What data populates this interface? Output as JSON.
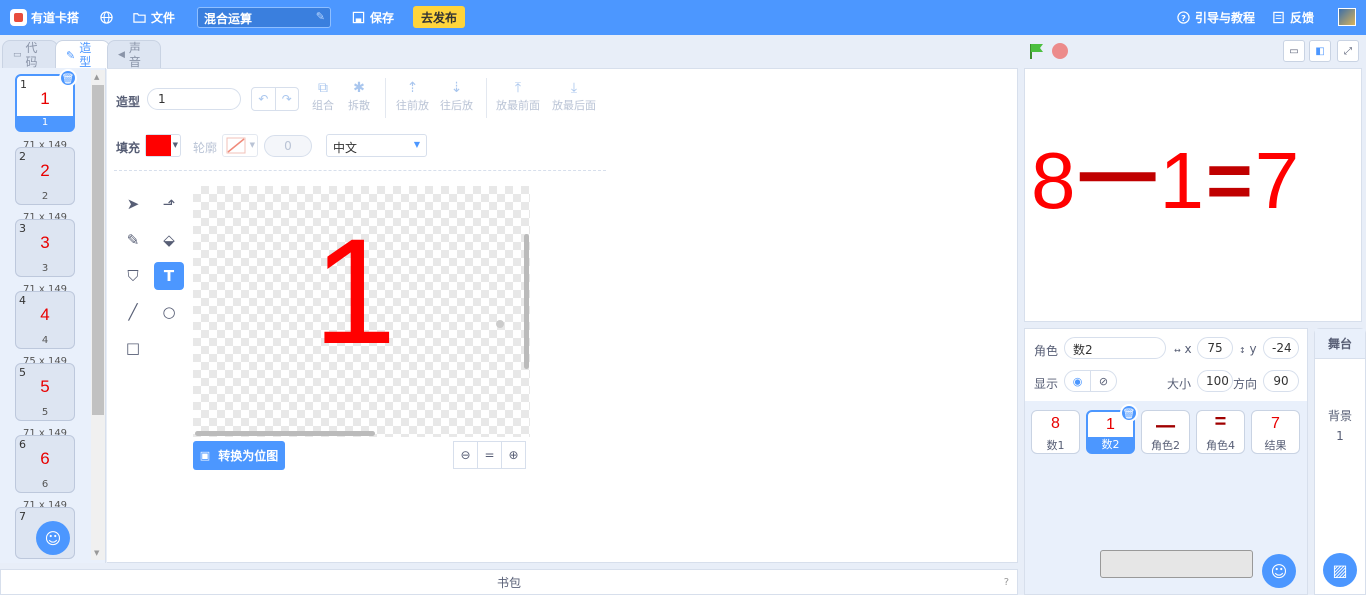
{
  "header": {
    "brand": "有道卡搭",
    "file_menu": "文件",
    "project_title": "混合运算",
    "save_label": "保存",
    "publish_label": "去发布",
    "guide_label": "引导与教程",
    "feedback_label": "反馈"
  },
  "tabs": {
    "code": [
      "代",
      "码"
    ],
    "costume": [
      "造",
      "型"
    ],
    "sound": [
      "声",
      "音"
    ]
  },
  "costumes": [
    {
      "num": "1",
      "glyph": "1",
      "name": "1",
      "size": "71 x 149"
    },
    {
      "num": "2",
      "glyph": "2",
      "name": "2",
      "size": "71 x 149"
    },
    {
      "num": "3",
      "glyph": "3",
      "name": "3",
      "size": "71 x 149"
    },
    {
      "num": "4",
      "glyph": "4",
      "name": "4",
      "size": "75 x 149"
    },
    {
      "num": "5",
      "glyph": "5",
      "name": "5",
      "size": "71 x 149"
    },
    {
      "num": "6",
      "glyph": "6",
      "name": "6",
      "size": "71 x 149"
    },
    {
      "num": "7"
    }
  ],
  "editor": {
    "costume_label": "造型",
    "costume_name": "1",
    "group": "组合",
    "ungroup": "拆散",
    "forward": "往前放",
    "backward": "往后放",
    "front": "放最前面",
    "back": "放最后面",
    "fill_label": "填充",
    "fill_color": "#ff0000",
    "outline_label": "轮廓",
    "outline_width": "0",
    "font": "中文",
    "canvas_glyph": "1",
    "convert_label": "转换为位图",
    "zoom_reset": "="
  },
  "backpack": "书包",
  "stage": {
    "parts": [
      "8",
      "一",
      "1",
      "=",
      "7"
    ]
  },
  "sprite_info": {
    "sprite_label": "角色",
    "sprite_name": "数2",
    "x_label": "x",
    "x": "75",
    "y_label": "y",
    "y": "-24",
    "show_label": "显示",
    "size_label": "大小",
    "size": "100",
    "direction_label": "方向",
    "direction": "90"
  },
  "sprites": [
    {
      "glyph": "8",
      "name": "数1"
    },
    {
      "glyph": "1",
      "name": "数2"
    },
    {
      "glyph": "一",
      "name": "角色2"
    },
    {
      "glyph": "=",
      "name": "角色4"
    },
    {
      "glyph": "7",
      "name": "结果"
    }
  ],
  "backdrop": {
    "tab": "舞台",
    "label": "背景",
    "count": "1"
  }
}
